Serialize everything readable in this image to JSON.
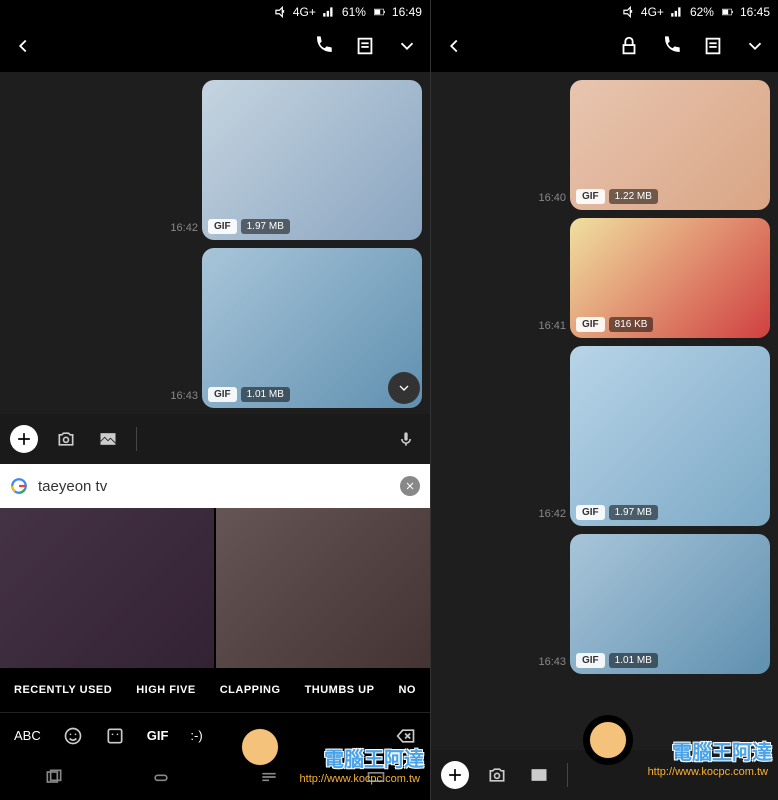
{
  "left": {
    "status": {
      "network": "4G+",
      "signal": "📶",
      "battery": "61%",
      "time": "16:49"
    },
    "messages": [
      {
        "time": "16:42",
        "gif_label": "GIF",
        "size": "1.97 MB"
      },
      {
        "time": "16:43",
        "gif_label": "GIF",
        "size": "1.01 MB"
      }
    ],
    "search": {
      "value": "taeyeon tv"
    },
    "categories": [
      "RECENTLY USED",
      "HIGH FIVE",
      "CLAPPING",
      "THUMBS UP",
      "NO"
    ],
    "keyboard": {
      "abc": "ABC",
      "gif": "GIF",
      "emoticon": ":-)"
    }
  },
  "right": {
    "status": {
      "network": "4G+",
      "battery": "62%",
      "time": "16:45"
    },
    "messages": [
      {
        "time": "16:40",
        "gif_label": "GIF",
        "size": "1.22 MB"
      },
      {
        "time": "16:41",
        "gif_label": "GIF",
        "size": "816 KB"
      },
      {
        "time": "16:42",
        "gif_label": "GIF",
        "size": "1.97 MB"
      },
      {
        "time": "16:43",
        "gif_label": "GIF",
        "size": "1.01 MB"
      }
    ]
  },
  "watermark": {
    "text": "電腦王阿達",
    "url": "http://www.kocpc.com.tw"
  }
}
